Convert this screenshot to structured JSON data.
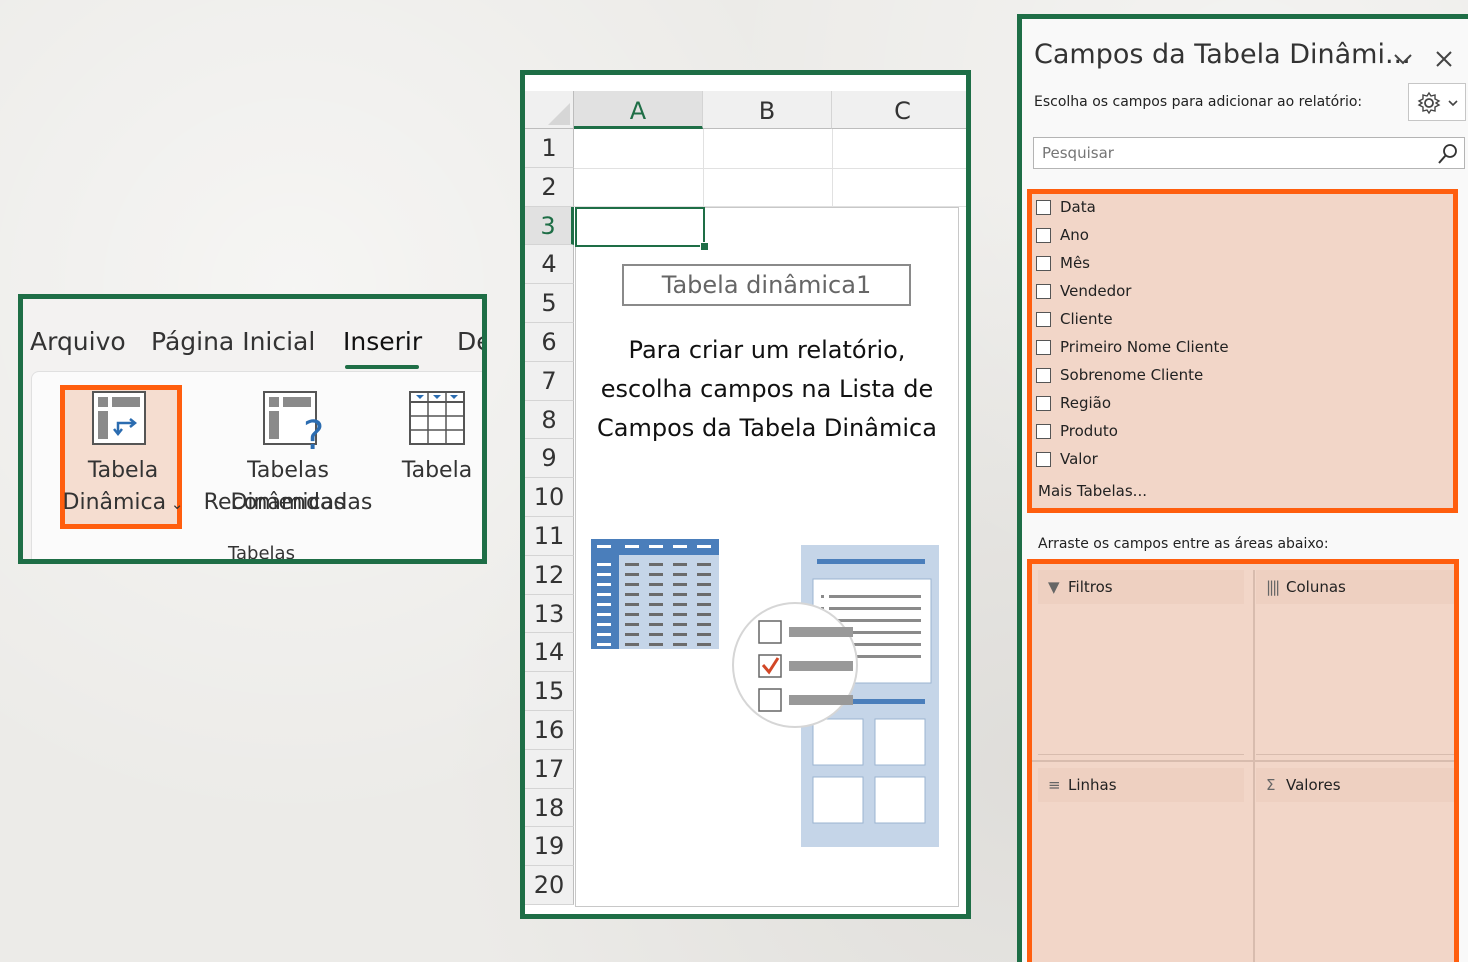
{
  "ribbon": {
    "tabs": [
      "Arquivo",
      "Página Inicial",
      "Inserir",
      "De"
    ],
    "active_tab": "Inserir",
    "buttons": {
      "pivot_line1": "Tabela",
      "pivot_line2": "Dinâmica",
      "recommended_line1": "Tabelas Dinâmicas",
      "recommended_line2": "Recomendadas",
      "table": "Tabela"
    },
    "group_label": "Tabelas"
  },
  "sheet": {
    "columns": [
      "A",
      "B",
      "C"
    ],
    "rows": [
      "1",
      "2",
      "3",
      "4",
      "5",
      "6",
      "7",
      "8",
      "9",
      "10",
      "11",
      "12",
      "13",
      "14",
      "15",
      "16",
      "17",
      "18",
      "19",
      "20"
    ],
    "active_row": "3",
    "pivot_name": "Tabela dinâmica1",
    "message_line1": "Para criar um relatório,",
    "message_line2": "escolha campos na Lista de",
    "message_line3": "Campos da Tabela Dinâmica"
  },
  "field_panel": {
    "title": "Campos da Tabela Dinâmi...",
    "subtitle": "Escolha os campos para adicionar ao relatório:",
    "search_placeholder": "Pesquisar",
    "fields": [
      "Data",
      "Ano",
      "Mês",
      "Vendedor",
      "Cliente",
      "Primeiro Nome Cliente",
      "Sobrenome Cliente",
      "Região",
      "Produto",
      "Valor"
    ],
    "more_tables": "Mais Tabelas...",
    "drag_hint": "Arraste os campos entre as áreas abaixo:",
    "areas": {
      "filters": "Filtros",
      "columns": "Colunas",
      "rows": "Linhas",
      "values": "Valores"
    },
    "icons": {
      "chevron": "chevron-down-icon",
      "close": "close-icon",
      "gear": "gear-icon",
      "search": "search-icon"
    }
  },
  "colors": {
    "frame_green": "#1e6e46",
    "highlight_orange": "#ff5e0e",
    "highlight_fill": "#f2d6c8",
    "excel_blue": "#4a7ebb"
  }
}
